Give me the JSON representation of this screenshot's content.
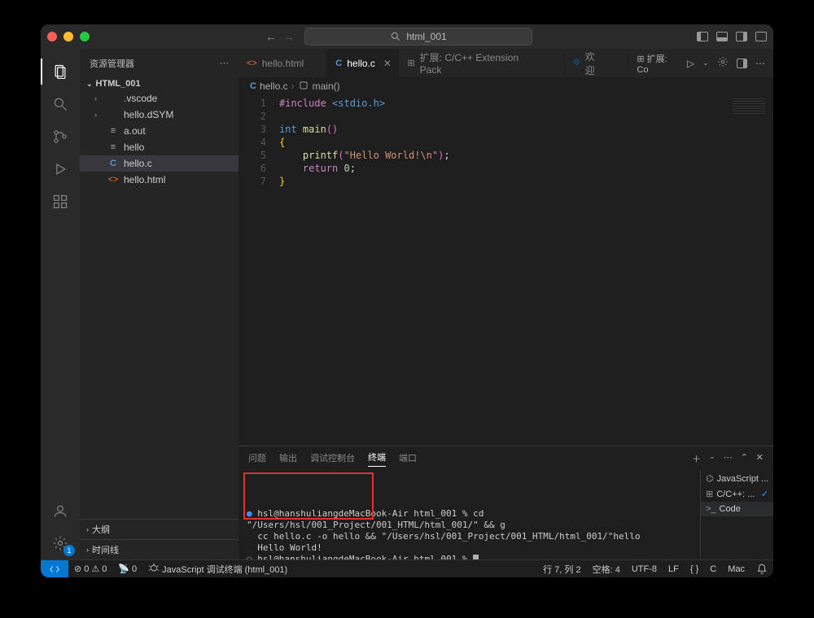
{
  "titlebar": {
    "search_text": "html_001"
  },
  "sidebar": {
    "header": "资源管理器",
    "root_folder": "HTML_001",
    "files": [
      {
        "name": ".vscode",
        "type": "folder",
        "chev": "›"
      },
      {
        "name": "hello.dSYM",
        "type": "folder",
        "chev": "›"
      },
      {
        "name": "a.out",
        "type": "file"
      },
      {
        "name": "hello",
        "type": "file"
      },
      {
        "name": "hello.c",
        "type": "c",
        "selected": true
      },
      {
        "name": "hello.html",
        "type": "html"
      }
    ],
    "outline": "大纲",
    "timeline": "时间线"
  },
  "tabs": [
    {
      "icon": "html",
      "label": "hello.html"
    },
    {
      "icon": "c",
      "label": "hello.c",
      "active": true
    },
    {
      "icon": "ext",
      "label": "扩展: C/C++ Extension Pack"
    },
    {
      "icon": "vs",
      "label": "欢迎"
    }
  ],
  "tab_actions_label": "扩展: Co",
  "breadcrumb": {
    "parts": [
      "hello.c",
      "main()"
    ]
  },
  "code": {
    "lines": [
      [
        {
          "t": "kw",
          "s": "#include "
        },
        {
          "t": "inc",
          "s": "<stdio.h>"
        }
      ],
      [],
      [
        {
          "t": "type",
          "s": "int "
        },
        {
          "t": "fn",
          "s": "main"
        },
        {
          "t": "paren1",
          "s": "()"
        }
      ],
      [
        {
          "t": "brack",
          "s": "{"
        }
      ],
      [
        {
          "t": "",
          "s": "    "
        },
        {
          "t": "fn",
          "s": "printf"
        },
        {
          "t": "paren1",
          "s": "("
        },
        {
          "t": "str",
          "s": "\"Hello World!\\n\""
        },
        {
          "t": "paren1",
          "s": ")"
        },
        {
          "t": "",
          "s": ";"
        }
      ],
      [
        {
          "t": "",
          "s": "    "
        },
        {
          "t": "kw",
          "s": "return "
        },
        {
          "t": "num",
          "s": "0"
        },
        {
          "t": "",
          "s": ";"
        }
      ],
      [
        {
          "t": "brack",
          "s": "}"
        }
      ]
    ]
  },
  "panel": {
    "tabs": [
      "问题",
      "输出",
      "调试控制台",
      "终端",
      "端口"
    ],
    "active_tab": 3,
    "terminal_lines": [
      "hsl@hanshuliangdeMacBook-Air html_001 % cd \"/Users/hsl/001_Project/001_HTML/html_001/\" && g",
      "cc hello.c -o hello && \"/Users/hsl/001_Project/001_HTML/html_001/\"hello",
      "Hello World!",
      "hsl@hanshuliangdeMacBook-Air html_001 % "
    ],
    "side_items": [
      {
        "icon": "bug",
        "label": "JavaScript ..."
      },
      {
        "icon": "ext",
        "label": "C/C++: ...",
        "check": true
      },
      {
        "icon": "code",
        "label": "Code",
        "selected": true
      }
    ]
  },
  "statusbar": {
    "errors": "0",
    "warnings": "0",
    "ports": "0",
    "debug": "JavaScript 调试终端 (html_001)",
    "line_col": "行 7, 列 2",
    "spaces": "空格: 4",
    "encoding": "UTF-8",
    "eol": "LF",
    "braces": "{ }",
    "lang": "C",
    "os": "Mac"
  },
  "activitybar": {
    "settings_badge": "1"
  }
}
